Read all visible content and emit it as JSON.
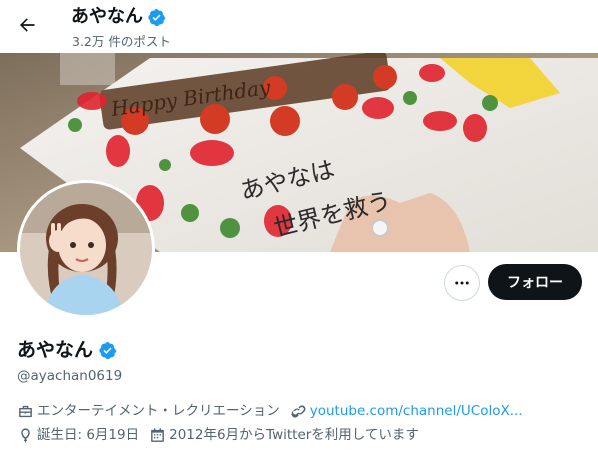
{
  "header": {
    "name": "あやなん",
    "post_count": "3.2万 件のポスト"
  },
  "banner": {
    "cake_text_line1": "あやなは",
    "cake_text_line2": "世界を救う",
    "chocolate_plate_text": "Happy Birthday"
  },
  "actions": {
    "follow_label": "フォロー"
  },
  "profile": {
    "name": "あやなん",
    "handle": "@ayachan0619",
    "category": "エンターテイメント・レクリエーション",
    "website": "youtube.com/channel/UColoX...",
    "birthday": "誕生日: 6月19日",
    "joined": "2012年6月からTwitterを利用しています"
  },
  "colors": {
    "verified": "#1d9bf0",
    "link": "#1d9bf0",
    "follow_bg": "#0f1419",
    "muted": "#536471"
  },
  "icons": [
    "back-arrow-icon",
    "verified-badge-icon",
    "more-icon",
    "briefcase-icon",
    "link-icon",
    "balloon-icon",
    "calendar-icon"
  ]
}
